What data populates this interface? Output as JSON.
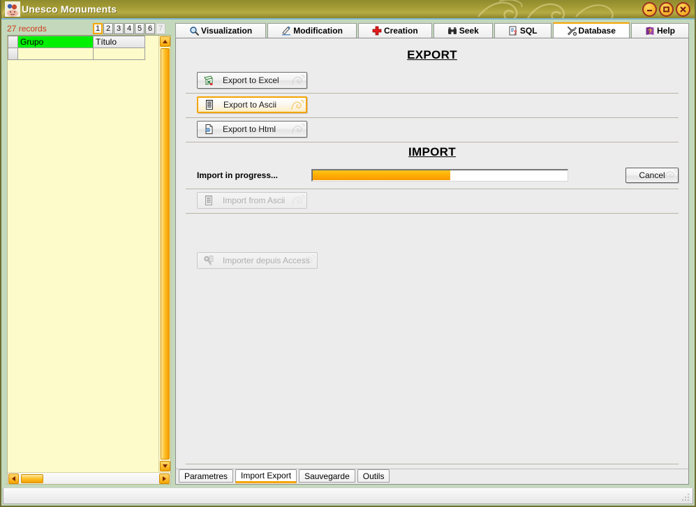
{
  "window": {
    "title": "Unesco Monuments",
    "icon": "app-people-icon",
    "buttons": [
      {
        "name": "minimize-button",
        "glyph": "minimize"
      },
      {
        "name": "maximize-button",
        "glyph": "maximize"
      },
      {
        "name": "close-button",
        "glyph": "close"
      }
    ]
  },
  "left": {
    "records_count": "27",
    "records_label": "records",
    "pages": [
      {
        "label": "1",
        "state": "active"
      },
      {
        "label": "2",
        "state": "enabled"
      },
      {
        "label": "3",
        "state": "enabled"
      },
      {
        "label": "4",
        "state": "enabled"
      },
      {
        "label": "5",
        "state": "enabled"
      },
      {
        "label": "6",
        "state": "enabled"
      },
      {
        "label": "7",
        "state": "disabled"
      }
    ],
    "grid": {
      "columns": [
        "Grupo",
        "Título"
      ],
      "rows": [
        [
          "",
          ""
        ]
      ],
      "selected_column": "Grupo",
      "selected_column_color": "#00f000"
    },
    "scroll": {
      "up_arrow": "scroll-up-icon",
      "down_arrow": "scroll-down-icon",
      "left_arrow": "scroll-left-icon",
      "right_arrow": "scroll-right-icon"
    }
  },
  "tabs": [
    {
      "label": "Visualization",
      "icon": "magnifier-icon",
      "active": false
    },
    {
      "label": "Modification",
      "icon": "pencil-ruler-icon",
      "active": false
    },
    {
      "label": "Creation",
      "icon": "red-cross-icon",
      "active": false
    },
    {
      "label": "Seek",
      "icon": "binoculars-icon",
      "active": false
    },
    {
      "label": "SQL",
      "icon": "sql-document-icon",
      "active": false
    },
    {
      "label": "Database",
      "icon": "tools-icon",
      "active": true
    },
    {
      "label": "Help",
      "icon": "help-book-icon",
      "active": false
    }
  ],
  "main": {
    "export": {
      "title": "EXPORT",
      "buttons": [
        {
          "label": "Export to Excel",
          "icon": "excel-icon",
          "state": "normal"
        },
        {
          "label": "Export to Ascii",
          "icon": "ascii-list-icon",
          "state": "hot"
        },
        {
          "label": "Export to Html",
          "icon": "html-page-icon",
          "state": "normal"
        }
      ]
    },
    "import": {
      "title": "IMPORT",
      "progress_label": "Import in progress...",
      "progress_percent": 54,
      "progress_color": "#ffa800",
      "cancel_label": "Cancel",
      "buttons": [
        {
          "label": "Import from Ascii",
          "icon": "ascii-list-icon",
          "state": "disabled"
        },
        {
          "label": "Importer depuis Access",
          "icon": "access-key-icon",
          "state": "disabled"
        }
      ]
    }
  },
  "bottom_tabs": [
    {
      "label": "Parametres",
      "active": false
    },
    {
      "label": "Import Export",
      "active": true
    },
    {
      "label": "Sauvegarde",
      "active": false
    },
    {
      "label": "Outils",
      "active": false
    }
  ],
  "colors": {
    "accent_orange": "#f5a400",
    "window_chrome": "#a39b34",
    "panel_green": "#c4d9bc",
    "grid_yellow": "#fdfbca"
  }
}
